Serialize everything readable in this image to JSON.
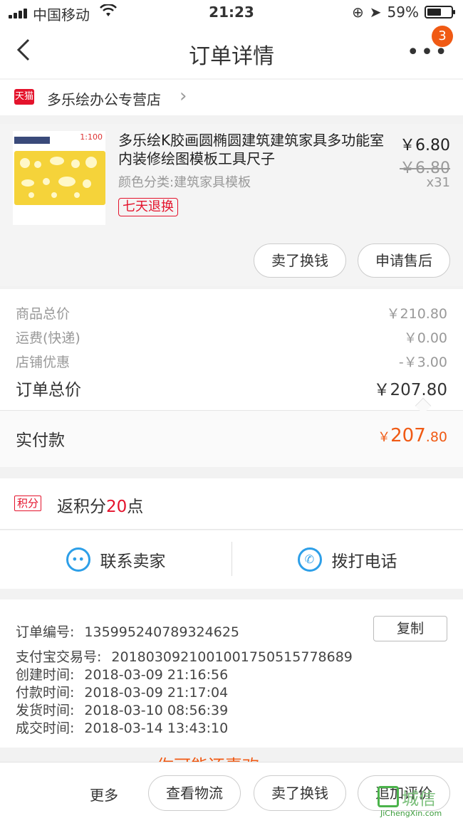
{
  "status_bar": {
    "carrier": "中国移动",
    "time": "21:23",
    "battery": "59%",
    "battery_level": 0.59
  },
  "nav": {
    "back_icon": "chevron-left-icon",
    "title": "订单详情",
    "more_label": "•••",
    "badge": "3"
  },
  "shop": {
    "badge": "天猫",
    "name": "多乐绘办公专营店"
  },
  "product": {
    "title": "多乐绘K胶画圆椭圆建筑建筑家具多功能室内装修绘图模板工具尺子",
    "spec": "颜色分类:建筑家具模板",
    "tag": "七天退换",
    "price": "￥6.80",
    "original_price": "￥6.80",
    "quantity": "x31",
    "image_text": "1:100",
    "buttons": [
      "卖了换钱",
      "申请售后"
    ]
  },
  "summary": {
    "rows": [
      {
        "label": "商品总价",
        "value": "￥210.80"
      },
      {
        "label": "运费(快递)",
        "value": "￥0.00"
      },
      {
        "label": "店铺优惠",
        "value": "-￥3.00"
      }
    ],
    "total_label": "订单总价",
    "total_value": "￥207.80",
    "paid_label": "实付款",
    "paid_currency": "￥",
    "paid_int": "207",
    "paid_dec": ".80"
  },
  "points": {
    "tag": "积分",
    "text_before": "返积分",
    "number": "20",
    "text_after": "点"
  },
  "contact": {
    "seller": "联系卖家",
    "phone": "拨打电话"
  },
  "order_info": {
    "lines": [
      {
        "label": "订单编号:",
        "value": "135995240789324625"
      },
      {
        "label": "支付宝交易号:",
        "value": "2018030921001001750515778689"
      },
      {
        "label": "创建时间:",
        "value": "2018-03-09 21:16:56"
      },
      {
        "label": "付款时间:",
        "value": "2018-03-09 21:17:04"
      },
      {
        "label": "发货时间:",
        "value": "2018-03-10 08:56:39"
      },
      {
        "label": "成交时间:",
        "value": "2018-03-14 13:43:10"
      }
    ],
    "copy_label": "复制"
  },
  "recommend_peek": "你可能还喜欢",
  "bottom_bar": {
    "more": "更多",
    "buttons": [
      "查看物流",
      "卖了换钱",
      "追加评价"
    ]
  },
  "watermark": {
    "text": "城信",
    "site": "JiChengXin.com"
  },
  "colors": {
    "accent": "#f05a14",
    "tmall_red": "#e4132c",
    "icon_blue": "#2d9fe8"
  }
}
